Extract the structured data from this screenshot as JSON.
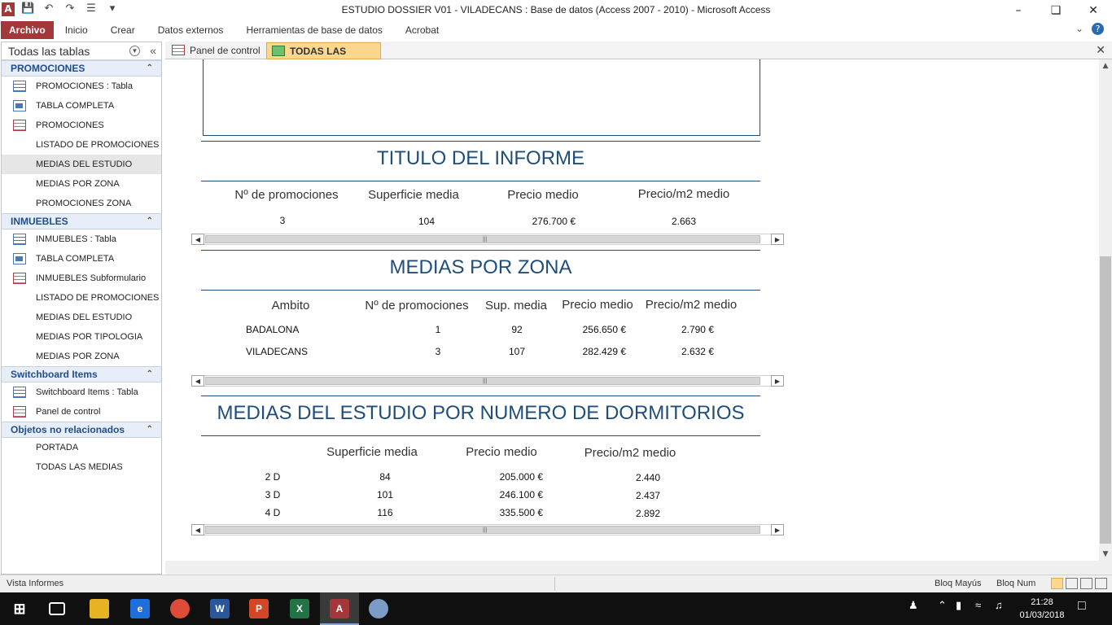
{
  "window": {
    "app_letter": "A",
    "title": "ESTUDIO DOSSIER V01 - VILADECANS : Base de datos (Access 2007 - 2010)  -  Microsoft Access"
  },
  "ribbon": {
    "tabs": [
      "Archivo",
      "Inicio",
      "Crear",
      "Datos externos",
      "Herramientas de base de datos",
      "Acrobat"
    ]
  },
  "nav": {
    "header": "Todas las tablas",
    "groups": [
      {
        "title": "PROMOCIONES",
        "items": [
          {
            "label": "PROMOCIONES : Tabla",
            "icon": "table-icon"
          },
          {
            "label": "TABLA COMPLETA",
            "icon": "query-icon"
          },
          {
            "label": "PROMOCIONES",
            "icon": "form-icon"
          },
          {
            "label": "LISTADO DE PROMOCIONES",
            "icon": "report-icon"
          },
          {
            "label": "MEDIAS DEL ESTUDIO",
            "icon": "report-icon",
            "selected": true
          },
          {
            "label": "MEDIAS POR ZONA",
            "icon": "report-icon"
          },
          {
            "label": "PROMOCIONES ZONA",
            "icon": "report-icon"
          }
        ]
      },
      {
        "title": "INMUEBLES",
        "items": [
          {
            "label": "INMUEBLES : Tabla",
            "icon": "table-icon"
          },
          {
            "label": "TABLA COMPLETA",
            "icon": "query-icon"
          },
          {
            "label": "INMUEBLES Subformulario",
            "icon": "form-icon"
          },
          {
            "label": "LISTADO DE PROMOCIONES",
            "icon": "report-icon"
          },
          {
            "label": "MEDIAS DEL ESTUDIO",
            "icon": "report-icon"
          },
          {
            "label": "MEDIAS POR TIPOLOGIA",
            "icon": "report-icon"
          },
          {
            "label": "MEDIAS POR ZONA",
            "icon": "report-icon"
          }
        ]
      },
      {
        "title": "Switchboard Items",
        "items": [
          {
            "label": "Switchboard Items : Tabla",
            "icon": "table-icon"
          },
          {
            "label": "Panel de control",
            "icon": "form-icon"
          }
        ]
      },
      {
        "title": "Objetos no relacionados",
        "items": [
          {
            "label": "PORTADA",
            "icon": "report-icon"
          },
          {
            "label": "TODAS LAS MEDIAS",
            "icon": "report-icon"
          }
        ]
      }
    ]
  },
  "doc_tabs": [
    {
      "label": "Panel de control",
      "active": false
    },
    {
      "label": "TODAS LAS MEDIAS",
      "active": true
    }
  ],
  "report": {
    "section1": {
      "title": "TITULO DEL INFORME",
      "headers": [
        "Nº de promociones",
        "Superficie media",
        "Precio medio",
        "Precio/m2 medio"
      ],
      "row": [
        "3",
        "104",
        "276.700 €",
        "2.663"
      ]
    },
    "section2": {
      "title": "MEDIAS POR ZONA",
      "headers": [
        "Ambito",
        "Nº de promociones",
        "Sup. media",
        "Precio medio",
        "Precio/m2 medio"
      ],
      "rows": [
        [
          "BADALONA",
          "1",
          "92",
          "256.650 €",
          "2.790 €"
        ],
        [
          "VILADECANS",
          "3",
          "107",
          "282.429 €",
          "2.632 €"
        ]
      ]
    },
    "section3": {
      "title": "MEDIAS DEL ESTUDIO POR NUMERO DE DORMITORIOS",
      "headers": [
        "Superficie media",
        "Precio medio",
        "Precio/m2 medio"
      ],
      "rows": [
        [
          "2 D",
          "84",
          "205.000 €",
          "2.440"
        ],
        [
          "3 D",
          "101",
          "246.100 €",
          "2.437"
        ],
        [
          "4 D",
          "116",
          "335.500 €",
          "2.892"
        ]
      ]
    }
  },
  "status": {
    "left": "Vista Informes",
    "caps": "Bloq Mayús",
    "num": "Bloq Num"
  },
  "taskbar": {
    "time": "21:28",
    "date": "01/03/2018"
  }
}
